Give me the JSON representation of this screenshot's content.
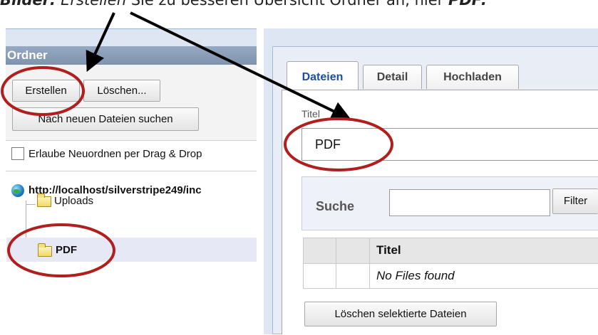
{
  "caption": {
    "lead": "Bilder:",
    "part1": " ",
    "emph": "Erstellen",
    "part2": " Sie zu besseren Übersicht Ordner an, hier ",
    "tail": "PDF:"
  },
  "folder_panel": {
    "header": "Ordner",
    "create_button": "Erstellen",
    "delete_button": "Löschen...",
    "search_new_button": "Nach neuen Dateien suchen",
    "dragdrop_label": "Erlaube Neuordnen per Drag & Drop",
    "tree": {
      "root": "http://localhost/silverstripe249/inc",
      "items": [
        {
          "label": "Uploads"
        },
        {
          "label": "PDF"
        }
      ]
    }
  },
  "detail_panel": {
    "tabs": [
      {
        "label": "Dateien"
      },
      {
        "label": "Detail"
      },
      {
        "label": "Hochladen"
      }
    ],
    "title_label": "Titel",
    "title_value": "PDF",
    "search_label": "Suche",
    "search_value": "",
    "filter_button": "Filter",
    "table": {
      "columns": [
        "",
        "",
        "Titel"
      ],
      "empty_message": "No Files found"
    },
    "delete_selected_button": "Löschen selektierte Dateien"
  },
  "colors": {
    "header_blue": "#8599b3",
    "highlight_circle": "#b01e1e",
    "active_tab_text": "#1c4fa3"
  },
  "icons": [
    "globe-icon",
    "folder-icon",
    "arrow-icon"
  ]
}
